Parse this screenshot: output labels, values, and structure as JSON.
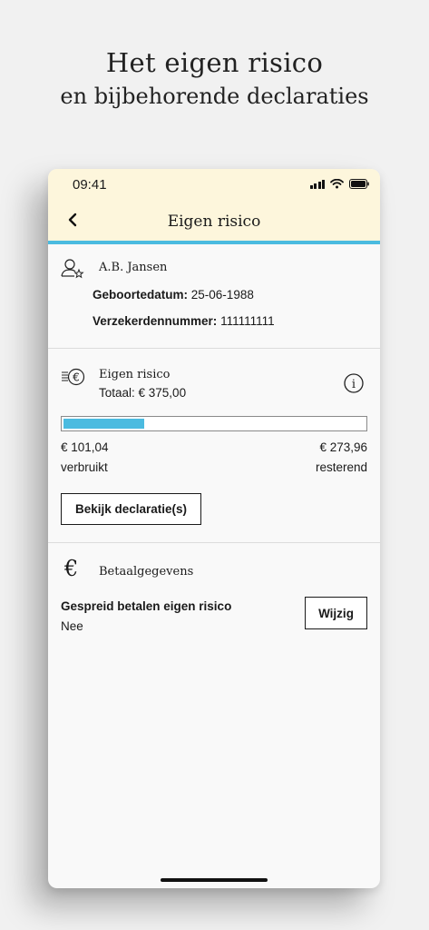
{
  "promo": {
    "title": "Het eigen risico",
    "subtitle": "en bijbehorende declaraties"
  },
  "status_bar": {
    "time": "09:41"
  },
  "nav": {
    "title": "Eigen risico",
    "back_icon": "chevron-left-icon"
  },
  "insured": {
    "icon": "person-star-icon",
    "name": "A.B. Jansen",
    "dob_label": "Geboortedatum:",
    "dob_value": "25-06-1988",
    "policy_label": "Verzekerdennummer:",
    "policy_value": "111111111"
  },
  "deductible": {
    "icon": "coins-euro-icon",
    "title": "Eigen risico",
    "total": "Totaal: € 375,00",
    "info_icon": "info-icon",
    "used_fraction": 0.269,
    "used_amount": "€ 101,04",
    "used_label": "verbruikt",
    "remaining_amount": "€ 273,96",
    "remaining_label": "resterend",
    "button_label": "Bekijk declaratie(s)",
    "bar_color": "#4bbbe0"
  },
  "payment": {
    "icon": "euro-icon",
    "title": "Betaalgegevens",
    "spread_label": "Gespreid betalen eigen risico",
    "spread_value": "Nee",
    "edit_label": "Wijzig"
  },
  "colors": {
    "header_bg": "#fdf6dc",
    "accent": "#4bbbe0",
    "background": "#f1f1f1"
  }
}
